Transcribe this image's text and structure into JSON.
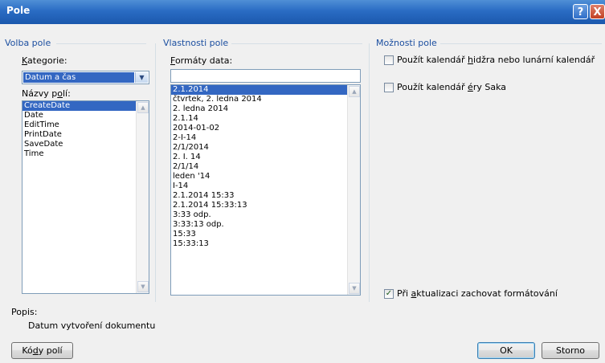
{
  "window": {
    "title": "Pole",
    "help_glyph": "?",
    "close_glyph": "X"
  },
  "volba": {
    "group_label": "Volba pole",
    "kategorie_label": "ategorie:",
    "kategorie_key": "K",
    "kategorie_value": "Datum a čas",
    "nazvy_label_pre": "Názvy p",
    "nazvy_key": "o",
    "nazvy_label_post": "lí:",
    "field_names": [
      "CreateDate",
      "Date",
      "EditTime",
      "PrintDate",
      "SaveDate",
      "Time"
    ],
    "selected_index": 0
  },
  "vlastnosti": {
    "group_label": "Vlastnosti pole",
    "formaty_key": "F",
    "formaty_label": "ormáty data:",
    "format_input_value": "",
    "formats": [
      "2.1.2014",
      "čtvrtek, 2. ledna 2014",
      "2. ledna 2014",
      "2.1.14",
      "2014-01-02",
      "2-I-14",
      "2/1/2014",
      "2. I. 14",
      "2/1/14",
      "leden '14",
      "I-14",
      "2.1.2014 15:33",
      "2.1.2014 15:33:13",
      "3:33 odp.",
      "3:33:13 odp.",
      "15:33",
      "15:33:13"
    ],
    "selected_index": 0
  },
  "moznosti": {
    "group_label": "Možnosti pole",
    "opt1_pre": "Použít kalendář ",
    "opt1_key": "h",
    "opt1_post": "idžra nebo lunární kalendář",
    "opt1_checked": false,
    "opt2_pre": "Použít kalendář ",
    "opt2_key": "é",
    "opt2_post": "ry Saka",
    "opt2_checked": false,
    "opt3_pre": "Při ",
    "opt3_key": "a",
    "opt3_post": "ktualizaci zachovat formátování",
    "opt3_checked": true
  },
  "popis": {
    "label": "Popis:",
    "text": "Datum vytvoření dokumentu"
  },
  "buttons": {
    "kody_key": "d",
    "kody_pre": "Kó",
    "kody_post": "y polí",
    "ok": "OK",
    "storno": "Storno"
  },
  "colors": {
    "titlebar": "#2a6cc4",
    "group_label": "#1c4fa0",
    "selection": "#3367c2"
  }
}
